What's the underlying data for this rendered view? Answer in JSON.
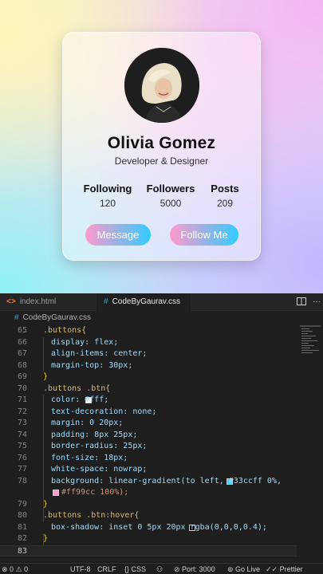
{
  "profile": {
    "name": "Olivia Gomez",
    "role": "Developer & Designer",
    "stats": [
      {
        "label": "Following",
        "value": "120"
      },
      {
        "label": "Followers",
        "value": "5000"
      },
      {
        "label": "Posts",
        "value": "209"
      }
    ],
    "buttons": {
      "message": "Message",
      "follow": "Follow Me"
    }
  },
  "editor": {
    "tabs": [
      {
        "label": "index.html",
        "icon": "html-icon"
      },
      {
        "label": "CodeByGaurav.css",
        "icon": "css-icon"
      }
    ],
    "breadcrumb": "CodeByGaurav.css",
    "lines": [
      {
        "n": "65",
        "t": ".buttons{"
      },
      {
        "n": "66",
        "t": "display: flex;"
      },
      {
        "n": "67",
        "t": "align-items: center;"
      },
      {
        "n": "68",
        "t": "margin-top: 30px;"
      },
      {
        "n": "69",
        "t": "}"
      },
      {
        "n": "70",
        "t": ".buttons .btn{"
      },
      {
        "n": "71",
        "t": "color: #fff;"
      },
      {
        "n": "72",
        "t": "text-decoration: none;"
      },
      {
        "n": "73",
        "t": "margin: 0 20px;"
      },
      {
        "n": "74",
        "t": "padding: 8px 25px;"
      },
      {
        "n": "75",
        "t": "border-radius: 25px;"
      },
      {
        "n": "76",
        "t": "font-size: 18px;"
      },
      {
        "n": "77",
        "t": "white-space: nowrap;"
      },
      {
        "n": "78",
        "t": "background: linear-gradient(to left, #33ccff 0%,"
      },
      {
        "n": "",
        "t": "#ff99cc 100%);"
      },
      {
        "n": "79",
        "t": "}"
      },
      {
        "n": "80",
        "t": ".buttons .btn:hover{"
      },
      {
        "n": "81",
        "t": "box-shadow: inset 0 5px 20px rgba(0,0,0,0.4);"
      },
      {
        "n": "82",
        "t": "}"
      },
      {
        "n": "83",
        "t": ""
      }
    ],
    "colors": {
      "white": "#fff",
      "cyan": "#33ccff",
      "pink": "#ff99cc",
      "black": "#000000"
    }
  },
  "statusbar": {
    "problems": "0",
    "warnings": "0",
    "encoding": "UTF-8",
    "eol": "CRLF",
    "lang": "CSS",
    "port": "Port: 3000",
    "golive": "Go Live",
    "prettier": "Prettier"
  }
}
